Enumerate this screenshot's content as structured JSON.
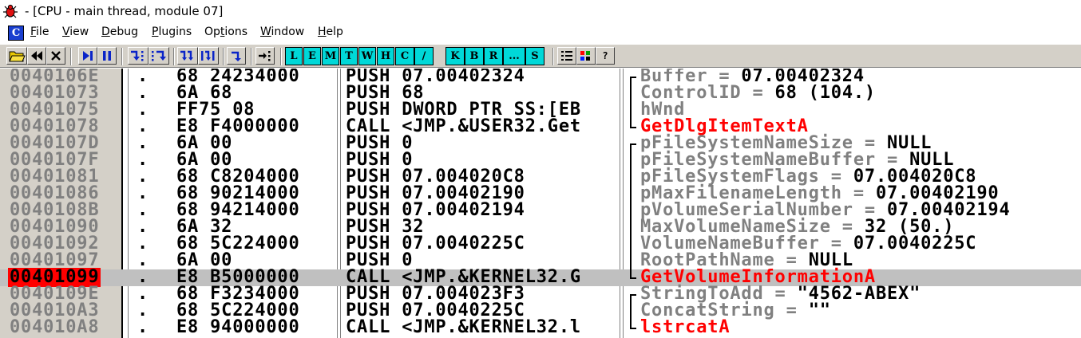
{
  "window": {
    "title": "- [CPU - main thread, module 07]",
    "icon": "ollydbg-bug-icon"
  },
  "menubar": {
    "badge": "C",
    "items": [
      {
        "label": "File",
        "u": "F",
        "rest": "ile"
      },
      {
        "label": "View",
        "u": "V",
        "rest": "iew"
      },
      {
        "label": "Debug",
        "u": "D",
        "rest": "ebug"
      },
      {
        "label": "Plugins",
        "u": "P",
        "rest": "lugins"
      },
      {
        "label": "Options",
        "pre": "Op",
        "u": "t",
        "rest": "ions"
      },
      {
        "label": "Window",
        "u": "W",
        "rest": "indow"
      },
      {
        "label": "Help",
        "u": "H",
        "rest": "elp"
      }
    ]
  },
  "toolbar": {
    "letters": [
      "L",
      "E",
      "M",
      "T",
      "W",
      "H",
      "C",
      "/",
      "K",
      "B",
      "R",
      "...",
      "S"
    ],
    "icons": [
      "open-icon",
      "restart-icon",
      "close-icon",
      "run-icon",
      "pause-icon",
      "step-into-icon",
      "step-over-icon",
      "trace-into-icon",
      "trace-over-icon",
      "execute-till-return-icon",
      "go-to-origin-icon",
      "list-icon",
      "grid-icon",
      "help-icon"
    ],
    "help_label": "?"
  },
  "colors": {
    "selected_address_bg": "#ff0000",
    "api_name": "#ff0000",
    "address_text": "#808080",
    "toolbar_letter_bg": "#00d8d8"
  },
  "disassembly": {
    "selected_address": "00401099",
    "rows": [
      {
        "address": "0040106E",
        "mark": ".",
        "hex": "68 24234000",
        "disasm": "PUSH 07.00402324",
        "arg": "Buffer = ",
        "val": "07.00402324",
        "api": "",
        "bracket": "top"
      },
      {
        "address": "00401073",
        "mark": ".",
        "hex": "6A 68",
        "disasm": "PUSH 68",
        "arg": "ControlID = ",
        "val": "68 (104.)",
        "api": "",
        "bracket": "mid"
      },
      {
        "address": "00401075",
        "mark": ".",
        "hex": "FF75 08",
        "disasm": "PUSH DWORD PTR SS:[EB",
        "arg": "hWnd",
        "val": "",
        "api": "",
        "bracket": "mid"
      },
      {
        "address": "00401078",
        "mark": ".",
        "hex": "E8 F4000000",
        "disasm": "CALL <JMP.&USER32.Get",
        "arg": "",
        "val": "",
        "api": "GetDlgItemTextA",
        "bracket": "bottom"
      },
      {
        "address": "0040107D",
        "mark": ".",
        "hex": "6A 00",
        "disasm": "PUSH 0",
        "arg": "pFileSystemNameSize = ",
        "val": "NULL",
        "api": "",
        "bracket": "top"
      },
      {
        "address": "0040107F",
        "mark": ".",
        "hex": "6A 00",
        "disasm": "PUSH 0",
        "arg": "pFileSystemNameBuffer = ",
        "val": "NULL",
        "api": "",
        "bracket": "mid"
      },
      {
        "address": "00401081",
        "mark": ".",
        "hex": "68 C8204000",
        "disasm": "PUSH 07.004020C8",
        "arg": "pFileSystemFlags = ",
        "val": "07.004020C8",
        "api": "",
        "bracket": "mid"
      },
      {
        "address": "00401086",
        "mark": ".",
        "hex": "68 90214000",
        "disasm": "PUSH 07.00402190",
        "arg": "pMaxFilenameLength = ",
        "val": "07.00402190",
        "api": "",
        "bracket": "mid"
      },
      {
        "address": "0040108B",
        "mark": ".",
        "hex": "68 94214000",
        "disasm": "PUSH 07.00402194",
        "arg": "pVolumeSerialNumber = ",
        "val": "07.00402194",
        "api": "",
        "bracket": "mid"
      },
      {
        "address": "00401090",
        "mark": ".",
        "hex": "6A 32",
        "disasm": "PUSH 32",
        "arg": "MaxVolumeNameSize = ",
        "val": "32 (50.)",
        "api": "",
        "bracket": "mid"
      },
      {
        "address": "00401092",
        "mark": ".",
        "hex": "68 5C224000",
        "disasm": "PUSH 07.0040225C",
        "arg": "VolumeNameBuffer = ",
        "val": "07.0040225C",
        "api": "",
        "bracket": "mid"
      },
      {
        "address": "00401097",
        "mark": ".",
        "hex": "6A 00",
        "disasm": "PUSH 0",
        "arg": "RootPathName = ",
        "val": "NULL",
        "api": "",
        "bracket": "mid"
      },
      {
        "address": "00401099",
        "mark": ".",
        "hex": "E8 B5000000",
        "disasm": "CALL <JMP.&KERNEL32.G",
        "arg": "",
        "val": "",
        "api": "GetVolumeInformationA",
        "bracket": "bottom"
      },
      {
        "address": "0040109E",
        "mark": ".",
        "hex": "68 F3234000",
        "disasm": "PUSH 07.004023F3",
        "arg": "StringToAdd = ",
        "val": "\"4562-ABEX\"",
        "api": "",
        "bracket": "top"
      },
      {
        "address": "004010A3",
        "mark": ".",
        "hex": "68 5C224000",
        "disasm": "PUSH 07.0040225C",
        "arg": "ConcatString = ",
        "val": "\"\"",
        "api": "",
        "bracket": "mid"
      },
      {
        "address": "004010A8",
        "mark": ".",
        "hex": "E8 94000000",
        "disasm": "CALL <JMP.&KERNEL32.l",
        "arg": "",
        "val": "",
        "api": "lstrcatA",
        "bracket": "bottom"
      }
    ]
  }
}
